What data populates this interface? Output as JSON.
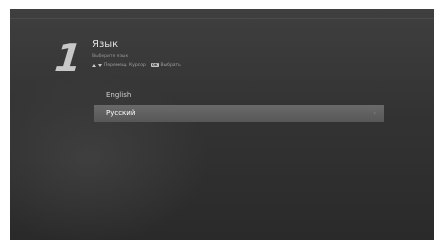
{
  "step": {
    "number": "1",
    "title": "Язык",
    "subtitle": "Выберите язык",
    "hint_move": "Перемещ. Курсор",
    "hint_ok_key": "OK",
    "hint_select": "Выбрать"
  },
  "languages": [
    {
      "label": "English",
      "selected": false
    },
    {
      "label": "Русский",
      "selected": true
    }
  ],
  "colors": {
    "background": "#333333",
    "selected_row": "#606060",
    "text": "#e0e0e0"
  }
}
